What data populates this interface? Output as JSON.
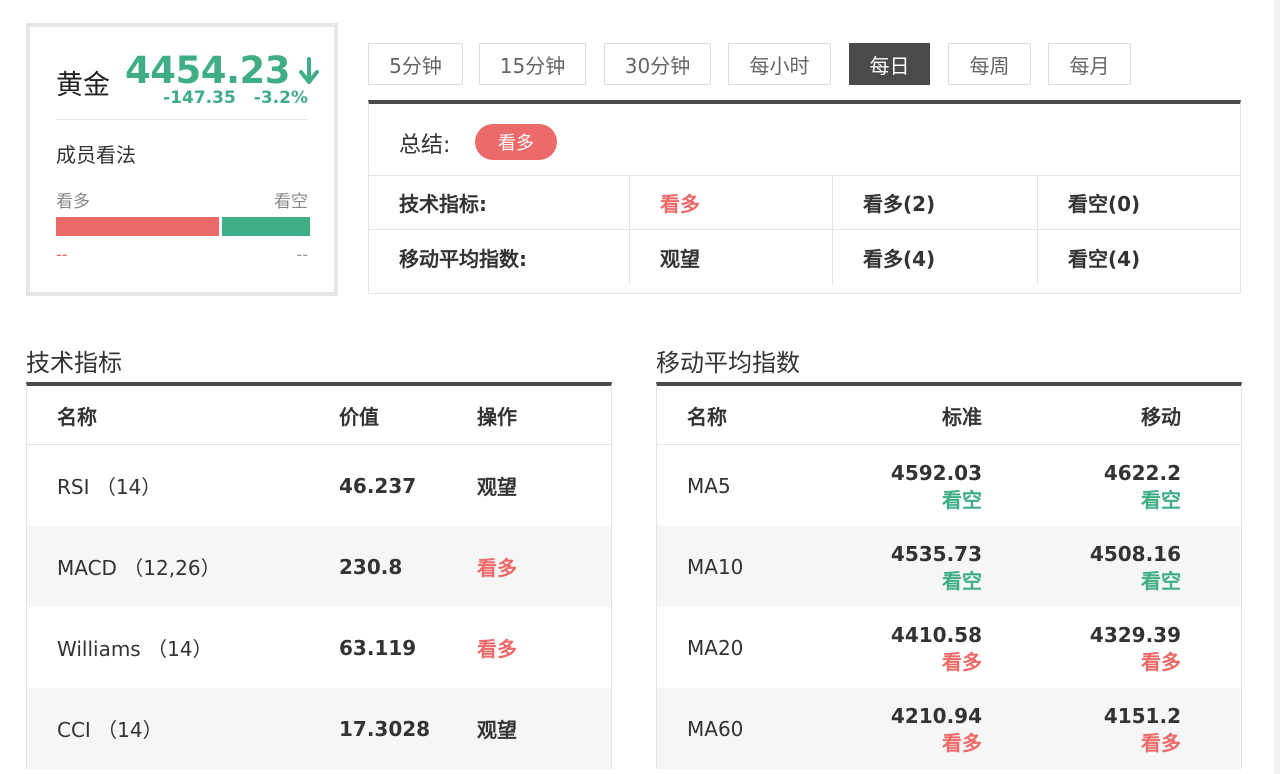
{
  "quote": {
    "name": "黄金",
    "price": "4454.23",
    "change": "-147.35",
    "change_pct": "-3.2%",
    "opinion_title": "成员看法",
    "bull_label": "看多",
    "bear_label": "看空",
    "bull_value": "--",
    "bear_value": "--",
    "bull_ratio": 0.64
  },
  "tabs": [
    {
      "label": "5分钟",
      "active": false
    },
    {
      "label": "15分钟",
      "active": false
    },
    {
      "label": "30分钟",
      "active": false
    },
    {
      "label": "每小时",
      "active": false
    },
    {
      "label": "每日",
      "active": true
    },
    {
      "label": "每周",
      "active": false
    },
    {
      "label": "每月",
      "active": false
    }
  ],
  "summary": {
    "label": "总结:",
    "badge": "看多",
    "rows": [
      {
        "label": "技术指标:",
        "signal": "看多",
        "signal_color": "#ec6a6a",
        "bull": "看多(2)",
        "bear": "看空(0)"
      },
      {
        "label": "移动平均指数:",
        "signal": "观望",
        "signal_color": "#333333",
        "bull": "看多(4)",
        "bear": "看空(4)"
      }
    ]
  },
  "tech": {
    "title": "技术指标",
    "headers": {
      "name": "名称",
      "value": "价值",
      "action": "操作"
    },
    "rows": [
      {
        "name": "RSI （14）",
        "value": "46.237",
        "action": "观望",
        "color": "#333333"
      },
      {
        "name": "MACD （12,26）",
        "value": "230.8",
        "action": "看多",
        "color": "#ec6a6a"
      },
      {
        "name": "Williams （14）",
        "value": "63.119",
        "action": "看多",
        "color": "#ec6a6a"
      },
      {
        "name": "CCI （14）",
        "value": "17.3028",
        "action": "观望",
        "color": "#333333"
      }
    ]
  },
  "ma": {
    "title": "移动平均指数",
    "headers": {
      "name": "名称",
      "standard": "标准",
      "moving": "移动"
    },
    "rows": [
      {
        "name": "MA5",
        "std_value": "4592.03",
        "std_signal": "看空",
        "std_color": "#3fae84",
        "mov_value": "4622.2",
        "mov_signal": "看空",
        "mov_color": "#3fae84"
      },
      {
        "name": "MA10",
        "std_value": "4535.73",
        "std_signal": "看空",
        "std_color": "#3fae84",
        "mov_value": "4508.16",
        "mov_signal": "看空",
        "mov_color": "#3fae84"
      },
      {
        "name": "MA20",
        "std_value": "4410.58",
        "std_signal": "看多",
        "std_color": "#ec6a6a",
        "mov_value": "4329.39",
        "mov_signal": "看多",
        "mov_color": "#ec6a6a"
      },
      {
        "name": "MA60",
        "std_value": "4210.94",
        "std_signal": "看多",
        "std_color": "#ec6a6a",
        "mov_value": "4151.2",
        "mov_signal": "看多",
        "mov_color": "#ec6a6a"
      }
    ]
  },
  "colors": {
    "bull": "#ec6a6a",
    "bear": "#3fae84",
    "dark": "#4a4a4a"
  }
}
